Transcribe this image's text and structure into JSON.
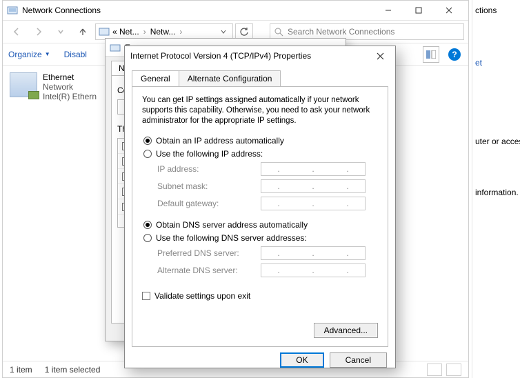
{
  "nc": {
    "title": "Network Connections",
    "breadcrumb": {
      "seg1": "« Net...",
      "seg2": "Netw..."
    },
    "search_placeholder": "Search Network Connections",
    "toolbar": {
      "organize": "Organize",
      "disable": "Disabl"
    },
    "adapter": {
      "name": "Ethernet",
      "line2": "Network",
      "line3": "Intel(R) Ethern"
    },
    "status": {
      "count": "1 item",
      "selected": "1 item selected"
    }
  },
  "bg": {
    "frag_title": "ctions",
    "frag_link": "et",
    "frag_text1": "uter or access",
    "frag_text2": "information."
  },
  "mid": {
    "title_fragment": "E",
    "tab": "Netw",
    "connect_label": "Co",
    "this_label": "Thi"
  },
  "ipv4": {
    "title": "Internet Protocol Version 4 (TCP/IPv4) Properties",
    "tabs": {
      "general": "General",
      "alt": "Alternate Configuration"
    },
    "desc": "You can get IP settings assigned automatically if your network supports this capability. Otherwise, you need to ask your network administrator for the appropriate IP settings.",
    "ip": {
      "auto": "Obtain an IP address automatically",
      "manual": "Use the following IP address:",
      "addr_label": "IP address:",
      "mask_label": "Subnet mask:",
      "gw_label": "Default gateway:"
    },
    "dns": {
      "auto": "Obtain DNS server address automatically",
      "manual": "Use the following DNS server addresses:",
      "pref_label": "Preferred DNS server:",
      "alt_label": "Alternate DNS server:"
    },
    "validate": "Validate settings upon exit",
    "advanced": "Advanced...",
    "ok": "OK",
    "cancel": "Cancel"
  }
}
